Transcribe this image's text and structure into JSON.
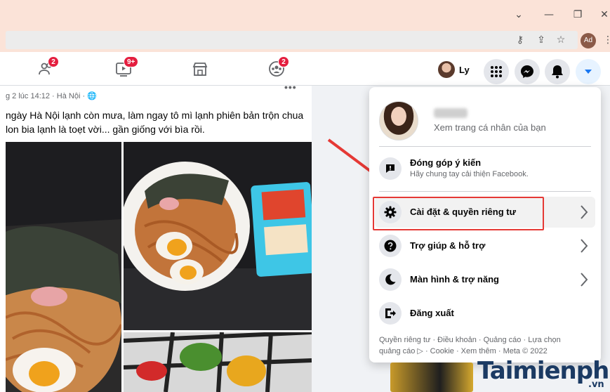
{
  "browser": {
    "window_controls": [
      "⌄",
      "—",
      "❐",
      "✕"
    ],
    "profile_initials": "Ad"
  },
  "fb_nav": {
    "tabs": [
      {
        "name": "friends",
        "badge": "2"
      },
      {
        "name": "watch",
        "badge": "9+"
      },
      {
        "name": "marketplace",
        "badge": ""
      },
      {
        "name": "groups",
        "badge": "2"
      }
    ],
    "profile_name": "Ly",
    "accent_color": "#1877f2"
  },
  "post": {
    "meta": "g 2 lúc 14:12 · Hà Nội · 🌐",
    "text_line1": "ngày Hà Nội lạnh còn mưa, làm ngay tô mì lạnh phiên bản trộn chua",
    "text_line2": "lon bia lạnh là toẹt vời... gần giống với bìa rồi.",
    "more": "•••"
  },
  "menu": {
    "profile_subtitle": "Xem trang cá nhân của bạn",
    "feedback_title": "Đóng góp ý kiến",
    "feedback_sub": "Hãy chung tay cải thiện Facebook.",
    "items": [
      {
        "label": "Cài đặt & quyền riêng tư",
        "icon": "gear-icon",
        "chevron": true
      },
      {
        "label": "Trợ giúp & hỗ trợ",
        "icon": "question-icon",
        "chevron": true
      },
      {
        "label": "Màn hình & trợ năng",
        "icon": "moon-icon",
        "chevron": true
      },
      {
        "label": "Đăng xuất",
        "icon": "logout-icon",
        "chevron": false
      }
    ],
    "footer_line1": "Quyền riêng tư · Điều khoản · Quảng cáo · Lựa chọn",
    "footer_line2": "quảng cáo ▷ · Cookie · Xem thêm · Meta © 2022"
  },
  "watermark": {
    "text": "Taimienphi",
    "sub": ".vn"
  },
  "annotation": {
    "arrow_color": "#e53935",
    "box_color": "#e53935"
  }
}
